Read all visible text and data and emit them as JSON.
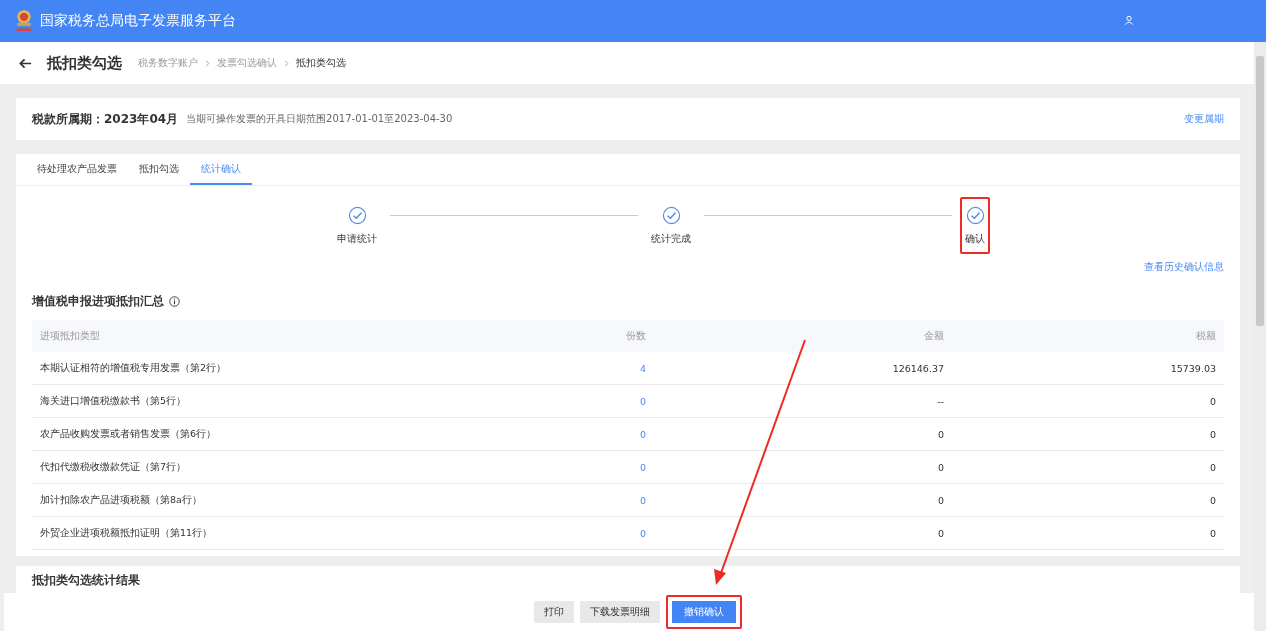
{
  "header": {
    "title": "国家税务总局电子发票服务平台"
  },
  "page": {
    "title": "抵扣类勾选",
    "breadcrumb": [
      {
        "label": "税务数字账户",
        "current": false
      },
      {
        "label": "发票勾选确认",
        "current": false
      },
      {
        "label": "抵扣类勾选",
        "current": true
      }
    ]
  },
  "period": {
    "label": "税款所属期：",
    "value": "2023年04月",
    "note": "当期可操作发票的开具日期范围2017-01-01至2023-04-30",
    "link": "变更属期"
  },
  "tabs": [
    {
      "label": "待处理农产品发票",
      "selected": false
    },
    {
      "label": "抵扣勾选",
      "selected": false
    },
    {
      "label": "统计确认",
      "selected": true
    }
  ],
  "steps": [
    {
      "label": "申请统计",
      "done": true,
      "highlighted": false
    },
    {
      "label": "统计完成",
      "done": true,
      "highlighted": false
    },
    {
      "label": "确认",
      "done": true,
      "highlighted": true
    }
  ],
  "history_link": "查看历史确认信息",
  "summary": {
    "title": "增值税申报进项抵扣汇总",
    "columns": [
      "进项抵扣类型",
      "份数",
      "金额",
      "税额"
    ],
    "rows": [
      [
        "本期认证相符的增值税专用发票（第2行）",
        "4",
        "126146.37",
        "15739.03"
      ],
      [
        "海关进口增值税缴款书（第5行）",
        "0",
        "--",
        "0"
      ],
      [
        "农产品收购发票或者销售发票（第6行）",
        "0",
        "0",
        "0"
      ],
      [
        "代扣代缴税收缴款凭证（第7行）",
        "0",
        "0",
        "0"
      ],
      [
        "加计扣除农产品进项税额（第8a行）",
        "0",
        "0",
        "0"
      ],
      [
        "外贸企业进项税额抵扣证明（第11行）",
        "0",
        "0",
        "0"
      ]
    ]
  },
  "result_section": {
    "title": "抵扣类勾选统计结果"
  },
  "footer_buttons": [
    {
      "label": "打印",
      "kind": "secondary",
      "highlighted": false
    },
    {
      "label": "下载发票明细",
      "kind": "secondary",
      "highlighted": false
    },
    {
      "label": "撤销确认",
      "kind": "primary",
      "highlighted": true
    }
  ]
}
